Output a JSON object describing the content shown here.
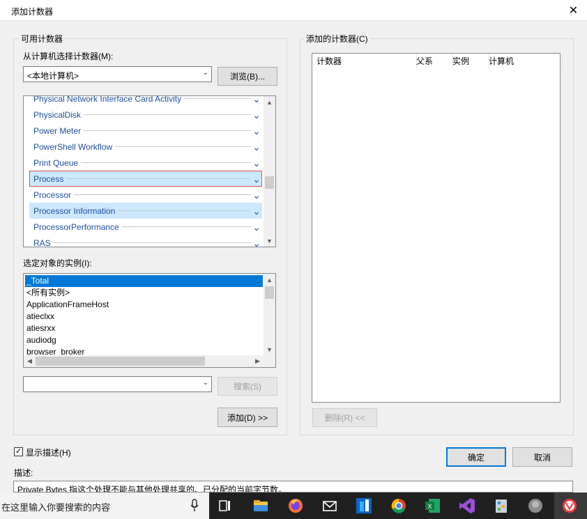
{
  "dialog": {
    "title": "添加计数器",
    "available": {
      "group_label": "可用计数器",
      "select_label": "从计算机选择计数器(M):",
      "computer_value": "<本地计算机>",
      "browse_label": "浏览(B)...",
      "objects": [
        {
          "label": "Physical Network Interface Card Activity",
          "state": "partial"
        },
        {
          "label": "PhysicalDisk",
          "state": "normal"
        },
        {
          "label": "Power Meter",
          "state": "normal"
        },
        {
          "label": "PowerShell Workflow",
          "state": "normal"
        },
        {
          "label": "Print Queue",
          "state": "normal"
        },
        {
          "label": "Process",
          "state": "selected"
        },
        {
          "label": "Processor",
          "state": "normal"
        },
        {
          "label": "Processor Information",
          "state": "hover"
        },
        {
          "label": "ProcessorPerformance",
          "state": "normal"
        },
        {
          "label": "RAS",
          "state": "normal"
        }
      ],
      "instances_label": "选定对象的实例(I):",
      "instances": [
        "_Total",
        "<所有实例>",
        "ApplicationFrameHost",
        "atieclxx",
        "atiesrxx",
        "audiodg",
        "browser_broker"
      ],
      "search_input_value": "",
      "search_label": "搜索(S)",
      "add_label": "添加(D) >>"
    },
    "added": {
      "group_label": "添加的计数器(C)",
      "columns": [
        "计数器",
        "父系",
        "实例",
        "计算机"
      ],
      "remove_label": "删除(R) <<"
    },
    "show_description_label": "显示描述(H)",
    "show_description_checked": true,
    "description_label": "描述:",
    "description_text": "Private Bytes 指这个处理不能与其他处理共享的、已分配的当前字节数。",
    "ok_label": "确定",
    "cancel_label": "取消"
  },
  "taskbar": {
    "search_placeholder": "在这里输入你要搜索的内容",
    "icons": [
      "mic-icon",
      "task-view-icon",
      "file-explorer-icon",
      "firefox-icon",
      "mail-icon",
      "app-blue-icon",
      "chrome-icon",
      "excel-icon",
      "visual-studio-icon",
      "app-box-icon",
      "app-gray-icon",
      "vivaldi-icon"
    ]
  },
  "colors": {
    "selection": "#0078d7",
    "link_text": "#1f4f9e",
    "row_highlight": "#cce8ff"
  }
}
